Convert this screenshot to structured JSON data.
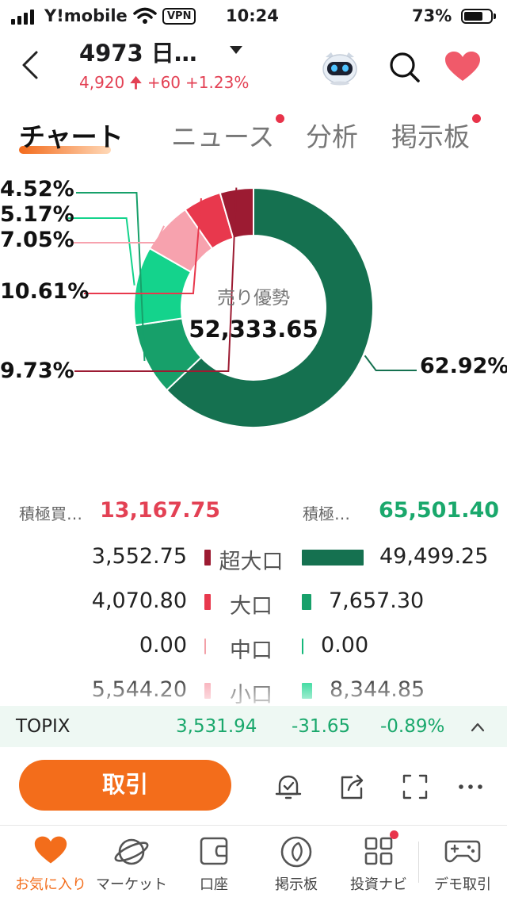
{
  "status_bar": {
    "carrier": "Y!mobile",
    "vpn": "VPN",
    "time": "10:24",
    "battery": "73%",
    "battery_level": 0.73
  },
  "header": {
    "stock_name": "4973  日…",
    "price": "4,920",
    "change": "+60",
    "change_pct": "+1.23%",
    "price_color": "#e34154"
  },
  "tabs": [
    {
      "label": "チャート",
      "active": true,
      "badge": false
    },
    {
      "label": "ニュース",
      "active": false,
      "badge": true
    },
    {
      "label": "分析",
      "active": false,
      "badge": false
    },
    {
      "label": "掲示板",
      "active": false,
      "badge": true
    }
  ],
  "chart_data": {
    "type": "pie",
    "center_label": "売り優勢",
    "center_value": "52,333.65",
    "slices": [
      {
        "label": "62.92%",
        "value": 62.92,
        "color": "#157150"
      },
      {
        "label": "9.73%",
        "value": 9.73,
        "color": "#17a06a"
      },
      {
        "label": "10.61%",
        "value": 10.61,
        "color": "#14d38c"
      },
      {
        "label": "7.05%",
        "value": 7.05,
        "color": "#f7a2ae"
      },
      {
        "label": "5.17%",
        "value": 5.17,
        "color": "#e8384d"
      },
      {
        "label": "4.52%",
        "value": 4.52,
        "color": "#9c1b32"
      }
    ]
  },
  "summary": {
    "buy_label": "積極買…",
    "buy_value": "13,167.75",
    "buy_color": "#e34154",
    "sell_label": "積極…",
    "sell_value": "65,501.40",
    "sell_color": "#1aa86c"
  },
  "flow_rows": [
    {
      "category": "超大口",
      "buy": "3,552.75",
      "sell": "49,499.25",
      "buy_fraction": 0.072,
      "sell_fraction": 1.0,
      "buy_color": "#9c1b32",
      "sell_color": "#157150"
    },
    {
      "category": "大口",
      "buy": "4,070.80",
      "sell": "7,657.30",
      "buy_fraction": 0.082,
      "sell_fraction": 0.155,
      "buy_color": "#e8384d",
      "sell_color": "#17a06a"
    },
    {
      "category": "中口",
      "buy": "0.00",
      "sell": "0.00",
      "buy_fraction": 0,
      "sell_fraction": 0,
      "buy_color": "#f2a0a8",
      "sell_color": "#14b87a"
    },
    {
      "category": "小口",
      "buy": "5,544.20",
      "sell": "8,344.85",
      "buy_fraction": 0.112,
      "sell_fraction": 0.169,
      "buy_color": "#f7a2ae",
      "sell_color": "#14d38c"
    }
  ],
  "index_bar": {
    "name": "TOPIX",
    "value": "3,531.94",
    "change": "-31.65",
    "change_pct": "-0.89%"
  },
  "action_bar": {
    "trade_label": "取引",
    "icons": [
      "alert-bell-icon",
      "share-icon",
      "fullscreen-icon",
      "more-icon"
    ]
  },
  "bottom_nav": [
    {
      "label": "お気に入り",
      "icon": "heart-icon",
      "active": true,
      "badge": false
    },
    {
      "label": "マーケット",
      "icon": "planet-icon",
      "active": false,
      "badge": false
    },
    {
      "label": "口座",
      "icon": "wallet-icon",
      "active": false,
      "badge": false
    },
    {
      "label": "掲示板",
      "icon": "board-icon",
      "active": false,
      "badge": false
    },
    {
      "label": "投資ナビ",
      "icon": "grid-icon",
      "active": false,
      "badge": true
    },
    {
      "label": "デモ取引",
      "icon": "gamepad-icon",
      "active": false,
      "badge": false
    }
  ],
  "colors": {
    "accent": "#f36d1b",
    "up": "#e34154",
    "down": "#1aa86c"
  }
}
